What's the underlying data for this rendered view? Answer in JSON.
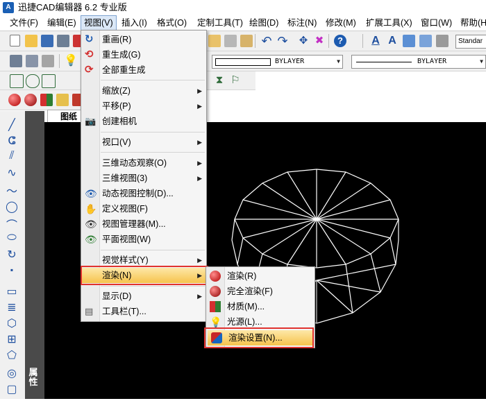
{
  "app": {
    "title": "迅捷CAD编辑器 6.2 专业版",
    "logo_text": "A"
  },
  "menubar": [
    "文件(F)",
    "编辑(E)",
    "视图(V)",
    "插入(I)",
    "格式(O)",
    "定制工具(T)",
    "绘图(D)",
    "标注(N)",
    "修改(M)",
    "扩展工具(X)",
    "窗口(W)",
    "帮助(H)"
  ],
  "toolbar": {
    "text_style_value": "Standar",
    "layer_color_value": "BYLAYER",
    "linetype_value": "BYLAYER"
  },
  "canvas": {
    "tab_label": "图纸"
  },
  "left_panel": {
    "properties_label": "属性"
  },
  "view_menu": {
    "items": [
      {
        "label": "重画(R)",
        "icon": "redraw-icon"
      },
      {
        "label": "重生成(G)",
        "icon": "regen-icon"
      },
      {
        "label": "全部重生成",
        "icon": "regen-all-icon"
      },
      {
        "label": "缩放(Z)",
        "submenu": true
      },
      {
        "label": "平移(P)",
        "submenu": true
      },
      {
        "label": "创建相机",
        "icon": "camera-icon"
      },
      {
        "label": "视口(V)",
        "submenu": true
      },
      {
        "label": "三维动态观察(O)",
        "submenu": true
      },
      {
        "label": "三维视图(3)",
        "submenu": true
      },
      {
        "label": "动态视图控制(D)...",
        "icon": "dynamic-view-icon"
      },
      {
        "label": "定义视图(F)",
        "icon": "define-view-icon"
      },
      {
        "label": "视图管理器(M)...",
        "icon": "view-manager-icon"
      },
      {
        "label": "平面视图(W)",
        "icon": "plan-view-icon"
      },
      {
        "label": "视觉样式(Y)",
        "submenu": true
      },
      {
        "label": "渲染(N)",
        "submenu": true,
        "highlighted": true
      },
      {
        "label": "显示(D)",
        "submenu": true
      },
      {
        "label": "工具栏(T)...",
        "icon": "toolbar-icon"
      }
    ]
  },
  "render_submenu": {
    "items": [
      {
        "label": "渲染(R)",
        "icon": "render-icon"
      },
      {
        "label": "完全渲染(F)",
        "icon": "full-render-icon"
      },
      {
        "label": "材质(M)...",
        "icon": "material-icon"
      },
      {
        "label": "光源(L)...",
        "icon": "light-icon"
      },
      {
        "label": "渲染设置(N)...",
        "icon": "render-settings-icon",
        "highlighted": true
      }
    ]
  },
  "colors": {
    "highlight": "#f6c34d",
    "annotation_box": "#e0322e",
    "canvas": "#000000",
    "wireframe": "#ffffff"
  }
}
